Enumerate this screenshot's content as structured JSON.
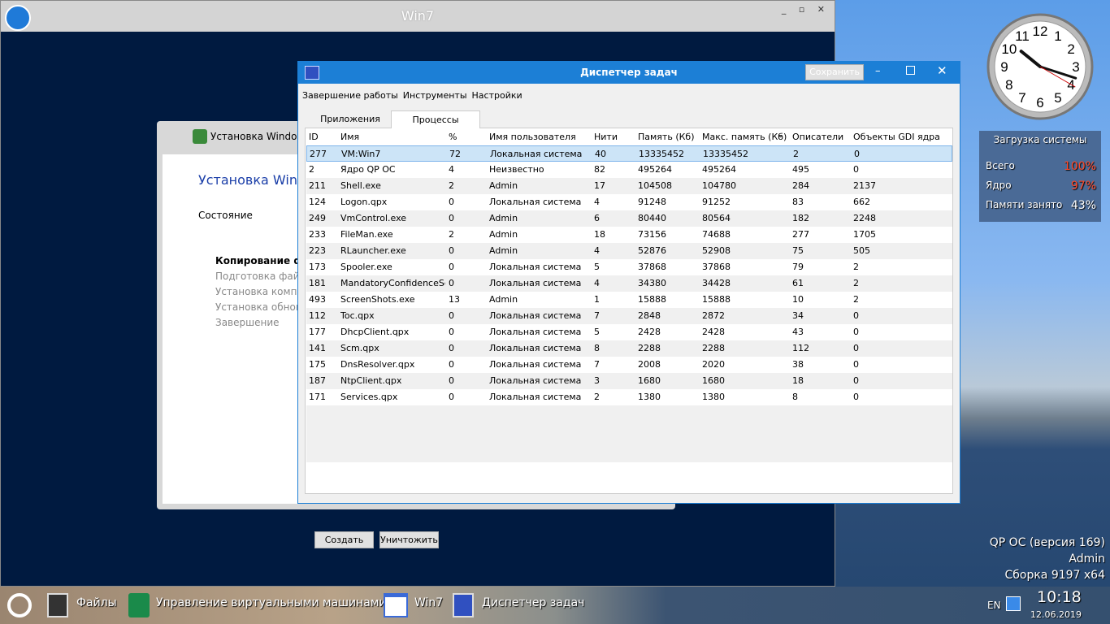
{
  "vm_window": {
    "title": "Win7",
    "controls": "_ ▫ ✕"
  },
  "installer": {
    "title": "Установка Windows",
    "heading": "Установка Windo",
    "status_label": "Состояние",
    "steps": [
      {
        "label": "Копирование фай",
        "active": true
      },
      {
        "label": "Подготовка файло",
        "active": false
      },
      {
        "label": "Установка компон",
        "active": false
      },
      {
        "label": "Установка обновл",
        "active": false
      },
      {
        "label": "Завершение",
        "active": false
      }
    ]
  },
  "task_manager": {
    "title": "Диспетчер задач",
    "save_button": "Сохранить",
    "menu": [
      "Завершение работы",
      "Инструменты",
      "Настройки"
    ],
    "tabs": [
      {
        "label": "Приложения",
        "active": false
      },
      {
        "label": "Процессы",
        "active": true
      }
    ],
    "columns": [
      "ID",
      "Имя",
      "%",
      "Имя пользователя",
      "Нити",
      "Память (Кб)",
      "Макс. память (Кб)",
      "Описатели",
      "Объекты GDI ядра"
    ],
    "sort_column": "Макс. память (Кб)",
    "rows": [
      [
        "277",
        "VM:Win7",
        "72",
        "Локальная система",
        "40",
        "13335452",
        "13335452",
        "2",
        "0"
      ],
      [
        "2",
        "Ядро QP OC",
        "4",
        "Неизвестно",
        "82",
        "495264",
        "495264",
        "495",
        "0"
      ],
      [
        "211",
        "Shell.exe",
        "2",
        "Admin",
        "17",
        "104508",
        "104780",
        "284",
        "2137"
      ],
      [
        "124",
        "Logon.qpx",
        "0",
        "Локальная система",
        "4",
        "91248",
        "91252",
        "83",
        "662"
      ],
      [
        "249",
        "VmControl.exe",
        "0",
        "Admin",
        "6",
        "80440",
        "80564",
        "182",
        "2248"
      ],
      [
        "233",
        "FileMan.exe",
        "2",
        "Admin",
        "18",
        "73156",
        "74688",
        "277",
        "1705"
      ],
      [
        "223",
        "RLauncher.exe",
        "0",
        "Admin",
        "4",
        "52876",
        "52908",
        "75",
        "505"
      ],
      [
        "173",
        "Spooler.exe",
        "0",
        "Локальная система",
        "5",
        "37868",
        "37868",
        "79",
        "2"
      ],
      [
        "181",
        "MandatoryConfidenceSe...",
        "0",
        "Локальная система",
        "4",
        "34380",
        "34428",
        "61",
        "2"
      ],
      [
        "493",
        "ScreenShots.exe",
        "13",
        "Admin",
        "1",
        "15888",
        "15888",
        "10",
        "2"
      ],
      [
        "112",
        "Toc.qpx",
        "0",
        "Локальная система",
        "7",
        "2848",
        "2872",
        "34",
        "0"
      ],
      [
        "177",
        "DhcpClient.qpx",
        "0",
        "Локальная система",
        "5",
        "2428",
        "2428",
        "43",
        "0"
      ],
      [
        "141",
        "Scm.qpx",
        "0",
        "Локальная система",
        "8",
        "2288",
        "2288",
        "112",
        "0"
      ],
      [
        "175",
        "DnsResolver.qpx",
        "0",
        "Локальная система",
        "7",
        "2008",
        "2020",
        "38",
        "0"
      ],
      [
        "187",
        "NtpClient.qpx",
        "0",
        "Локальная система",
        "3",
        "1680",
        "1680",
        "18",
        "0"
      ],
      [
        "171",
        "Services.qpx",
        "0",
        "Локальная система",
        "2",
        "1380",
        "1380",
        "8",
        "0"
      ]
    ],
    "selected_row": 0,
    "create_button": "Создать",
    "kill_button": "Уничтожить"
  },
  "gadget": {
    "title": "Загрузка системы",
    "items": [
      {
        "label": "Всего",
        "value": "100%",
        "color": "#ff4a2a"
      },
      {
        "label": "Ядро",
        "value": "97%",
        "color": "#ff4a2a"
      },
      {
        "label": "Памяти занято",
        "value": "43%",
        "color": "#ffffff"
      }
    ]
  },
  "clock": {
    "hour": 10,
    "minute": 18,
    "second": 20
  },
  "os_info": [
    "QP OC (версия 169)",
    "Admin",
    "Сборка 9197 x64"
  ],
  "taskbar": {
    "items": [
      "Файлы",
      "Управление виртуальными машинами",
      "Win7",
      "Диспетчер задач"
    ],
    "lang": "EN",
    "time": "10:18",
    "date": "12.06.2019"
  }
}
